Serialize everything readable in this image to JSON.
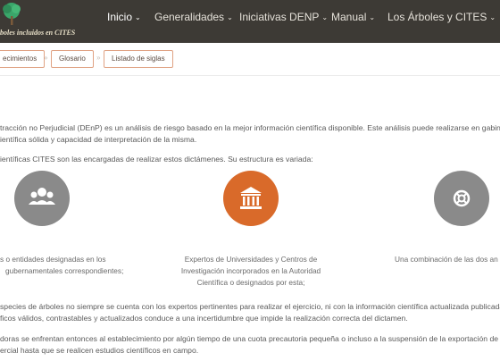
{
  "header": {
    "logo_text": "boles incluidos en CITES",
    "nav": [
      {
        "label": "Inicio"
      },
      {
        "label": "Generalidades"
      },
      {
        "label": "Iniciativas DENP"
      },
      {
        "label": "Manual"
      },
      {
        "label": "Los Árboles y CITES"
      }
    ]
  },
  "breadcrumbs": [
    "ecimientos",
    "Glosario",
    "Listado de siglas"
  ],
  "breadcrumb_separator": "»",
  "intro": {
    "line1": "tracción no Perjudicial (DEnP) es un análisis de riesgo basado en la mejor información científica disponible. Este análisis puede realizarse en gabinete",
    "line2": "ientífica sólida y capacidad de interpretación de la misma.",
    "line3": "ientíficas CITES son las encargadas de realizar estos dictámenes. Su estructura es variada:"
  },
  "cards": [
    {
      "icon": "users-icon",
      "color": "#8a8a8a",
      "lines": [
        "s o entidades designadas en los",
        "gubernamentales correspondientes;"
      ]
    },
    {
      "icon": "institution-icon",
      "color": "#d96a2a",
      "lines": [
        "Expertos de Universidades y Centros de",
        "Investigación incorporados en la Autoridad",
        "Científica o designados por esta;"
      ]
    },
    {
      "icon": "lifebuoy-icon",
      "color": "#8a8a8a",
      "lines": [
        "Una combinación de las dos an"
      ]
    }
  ],
  "outro": {
    "line1": "species de árboles no siempre se cuenta con los expertos pertinentes para realizar el ejercicio, ni con la información científica actualizada publicada.",
    "line2": "ficos válidos, contrastables y actualizados conduce a una incertidumbre que impide la realización correcta del dictamen.",
    "line3": "doras se enfrentan entonces al establecimiento por algún tiempo de una cuota precautoria pequeña o incluso a la suspensión de la exportación de e",
    "line4": "ercial hasta que se realicen estudios científicos en campo."
  }
}
